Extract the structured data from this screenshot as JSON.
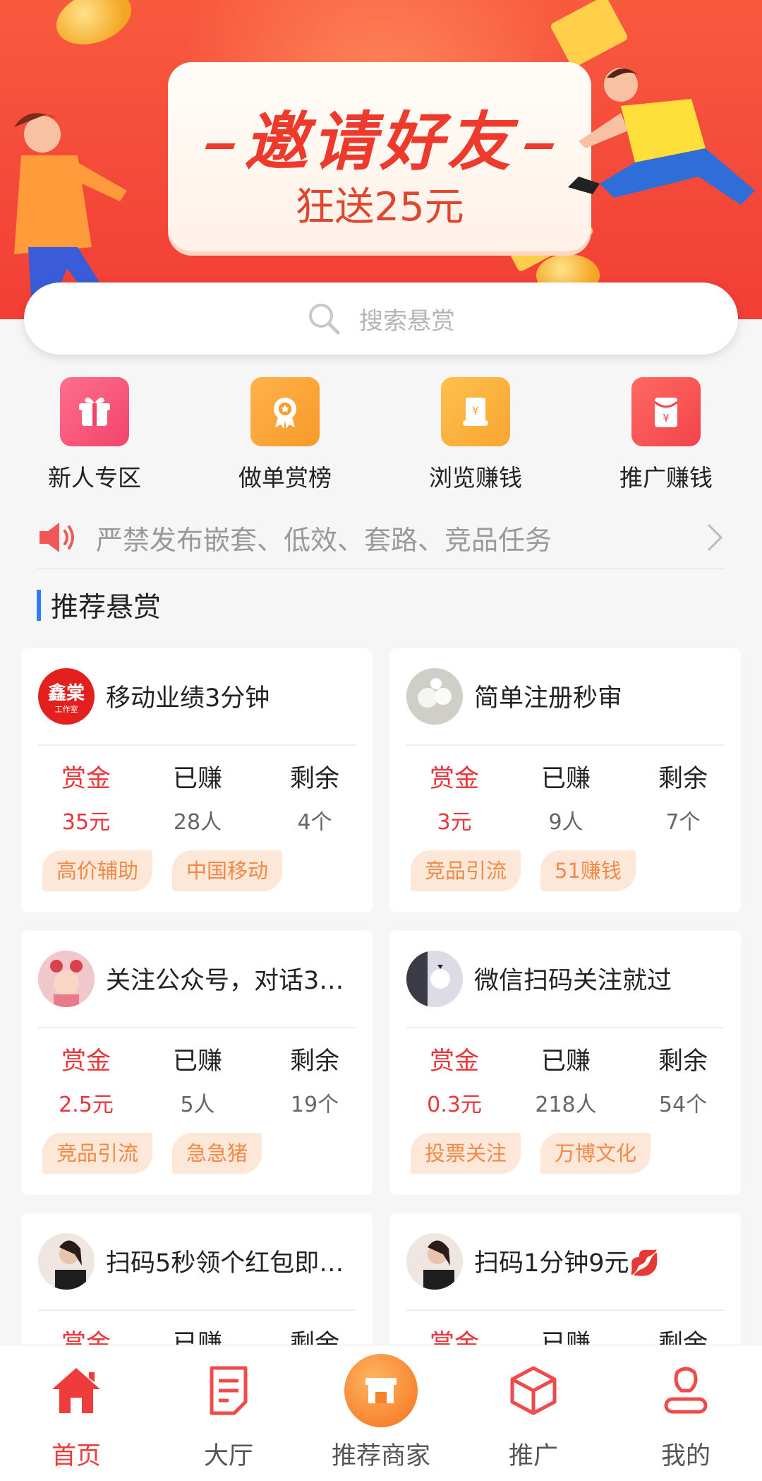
{
  "banner": {
    "title": "邀请好友",
    "subtitle": "狂送25元"
  },
  "search": {
    "placeholder": "搜索悬赏"
  },
  "quick_menu": [
    {
      "label": "新人专区",
      "icon": "gift-icon",
      "color": "#f2446b"
    },
    {
      "label": "做单赏榜",
      "icon": "medal-icon",
      "color": "#f79a2a"
    },
    {
      "label": "浏览赚钱",
      "icon": "scroll-icon",
      "color": "#f9a531"
    },
    {
      "label": "推广赚钱",
      "icon": "red-envelope-icon",
      "color": "#f3434a"
    }
  ],
  "notice": {
    "text": "严禁发布嵌套、低效、套路、竞品任务",
    "icon": "speaker-icon"
  },
  "section": {
    "title": "推荐悬赏"
  },
  "stat_labels": {
    "reward": "赏金",
    "earned": "已赚",
    "remaining": "剩余"
  },
  "tasks": [
    {
      "title": "移动业绩3分钟",
      "avatar": "鑫棠",
      "avatar_sub": "工作室",
      "reward": "35元",
      "earned": "28人",
      "remaining": "4个",
      "tags": [
        "高价辅助",
        "中国移动"
      ]
    },
    {
      "title": "简单注册秒审",
      "reward": "3元",
      "earned": "9人",
      "remaining": "7个",
      "tags": [
        "竞品引流",
        "51赚钱"
      ]
    },
    {
      "title": "关注公众号，对话3…",
      "reward": "2.5元",
      "earned": "5人",
      "remaining": "19个",
      "tags": [
        "竞品引流",
        "急急猪"
      ]
    },
    {
      "title": "微信扫码关注就过",
      "reward": "0.3元",
      "earned": "218人",
      "remaining": "54个",
      "tags": [
        "投票关注",
        "万博文化"
      ]
    },
    {
      "title": "扫码5秒领个红包即…"
    },
    {
      "title": "扫码1分钟9元💋"
    }
  ],
  "tabbar": [
    {
      "label": "首页",
      "icon": "home-icon",
      "active": true
    },
    {
      "label": "大厅",
      "icon": "document-icon"
    },
    {
      "label": "推荐商家",
      "icon": "store-icon"
    },
    {
      "label": "推广",
      "icon": "cube-icon"
    },
    {
      "label": "我的",
      "icon": "user-icon"
    }
  ],
  "colors": {
    "accent": "#ef3b3b",
    "tag_bg": "#fde7d8",
    "tag_text": "#f08a46",
    "section_bar": "#2f7bf5"
  }
}
